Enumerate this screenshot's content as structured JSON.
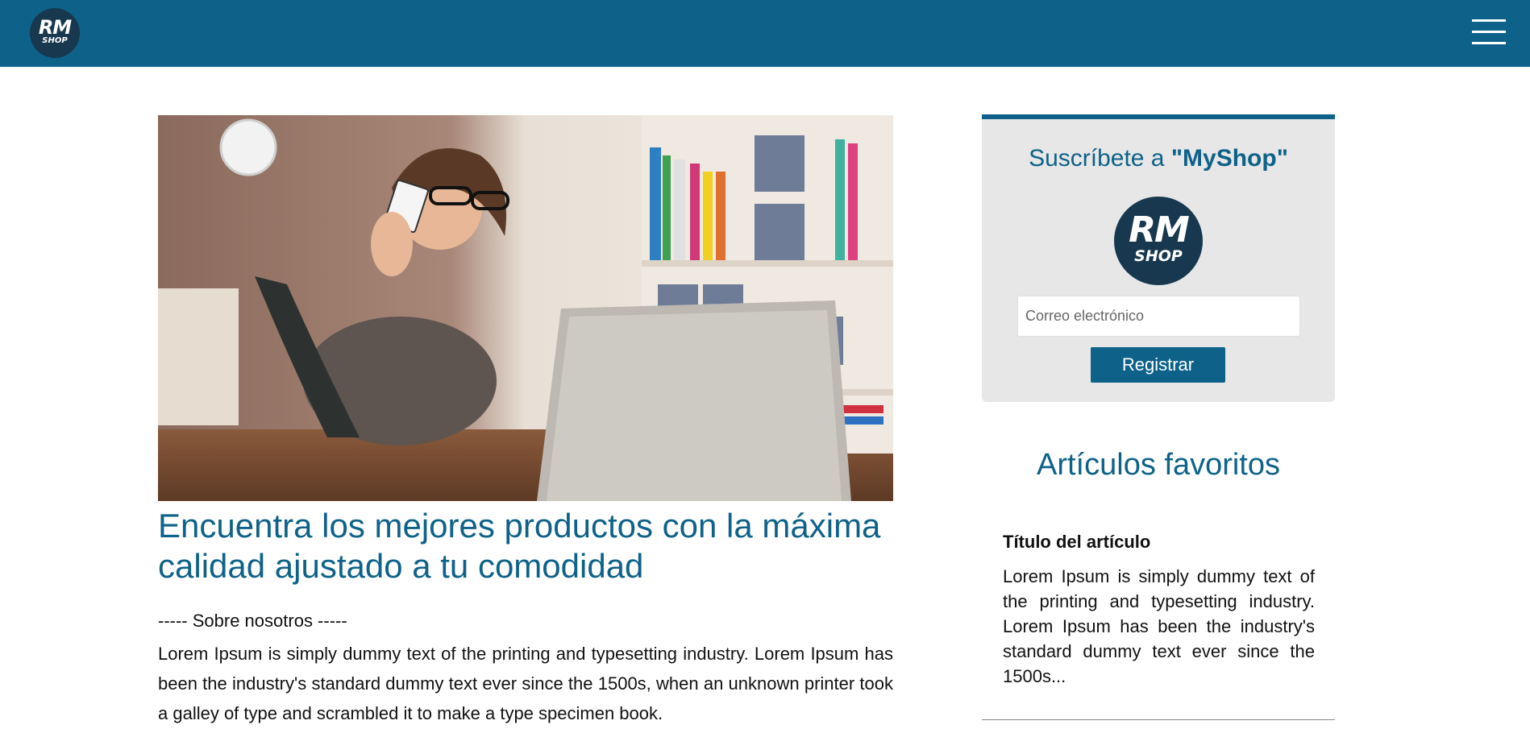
{
  "header": {
    "logo_rm": "RM",
    "logo_shop": "SHOP",
    "menu_icon": "hamburger-menu-icon"
  },
  "hero": {
    "image_description": "hero-photo"
  },
  "main": {
    "headline": "Encuentra los mejores productos con la máxima calidad ajustado a tu comodidad",
    "about_heading": "----- Sobre nosotros -----",
    "about_text": "Lorem Ipsum is simply dummy text of the printing and typesetting industry. Lorem Ipsum has been the industry's standard dummy text ever since the 1500s, when an unknown printer took a galley of type and scrambled it to make a type specimen book."
  },
  "subscribe": {
    "title_prefix": "Suscríbete a ",
    "title_brand": "\"MyShop\"",
    "logo_rm": "RM",
    "logo_shop": "SHOP",
    "email_placeholder": "Correo electrónico",
    "email_value": "",
    "register_label": "Registrar"
  },
  "favorites": {
    "title": "Artículos favoritos",
    "articles": [
      {
        "title": "Título del artículo",
        "text": "Lorem Ipsum is simply dummy text of the printing and typesetting industry. Lorem Ipsum has been the industry's standard dummy text ever since the 1500s..."
      }
    ]
  },
  "colors": {
    "brand": "#0e6289",
    "logo_bg": "#17384f",
    "panel_bg": "#e7e7e7"
  }
}
